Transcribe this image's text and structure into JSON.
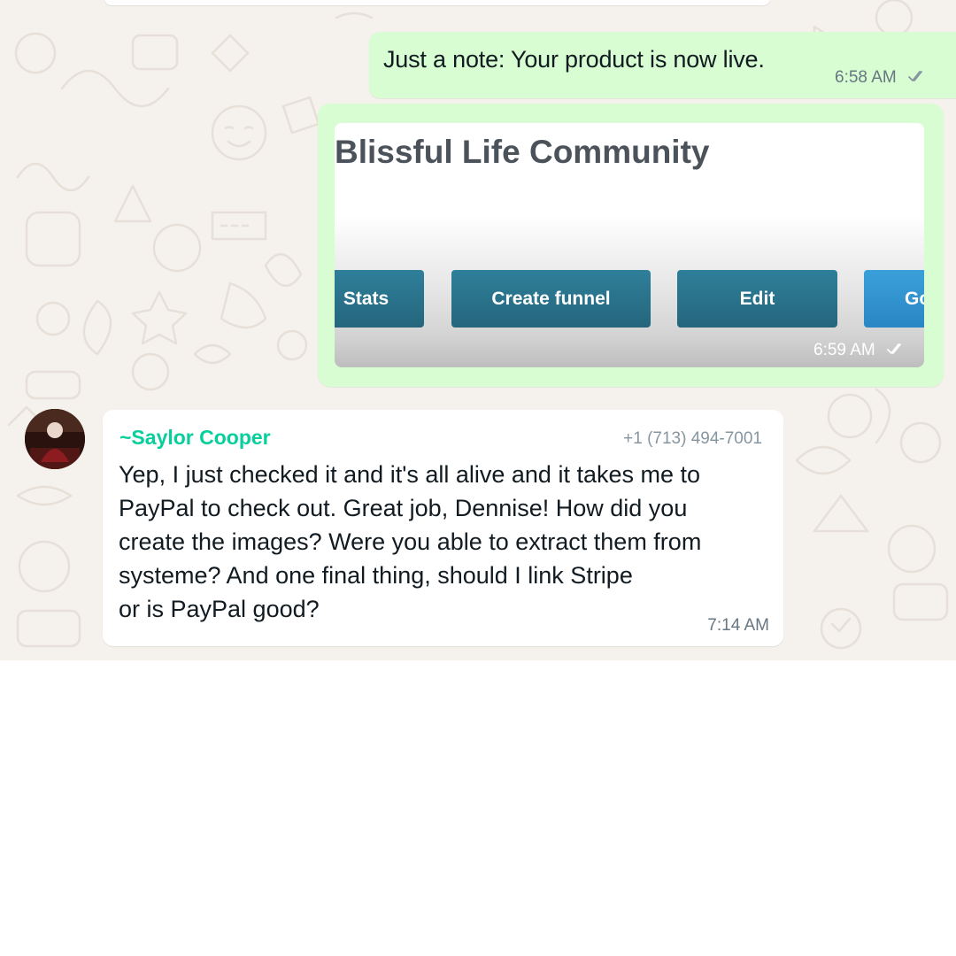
{
  "messages": {
    "outgoing_text": {
      "text": "Just a note: Your product is now live.",
      "time": "6:58 AM",
      "status_icon": "double-check-icon"
    },
    "outgoing_preview": {
      "title": "Blissful Life Community",
      "buttons": [
        "Stats",
        "Create funnel",
        "Edit",
        "Go"
      ],
      "time": "6:59 AM",
      "status_icon": "double-check-icon"
    },
    "incoming": {
      "sender": "~Saylor Cooper",
      "phone": "+1 (713) 494-7001",
      "text": "Yep, I just checked it and it's all alive and it takes me to\nPayPal to check out. Great job, Dennise! How did you\ncreate the images? Were you able to extract them from\nsysteme? And one final thing, should I link Stripe\nor is PayPal good?",
      "time": "7:14 AM"
    }
  },
  "colors": {
    "chat_background": "#f5f1ec",
    "outgoing_bubble": "#d9fdd3",
    "incoming_bubble": "#ffffff",
    "sender_name": "#06cf9c",
    "preview_button": "#24667c",
    "preview_button_alt": "#2a86c4"
  }
}
